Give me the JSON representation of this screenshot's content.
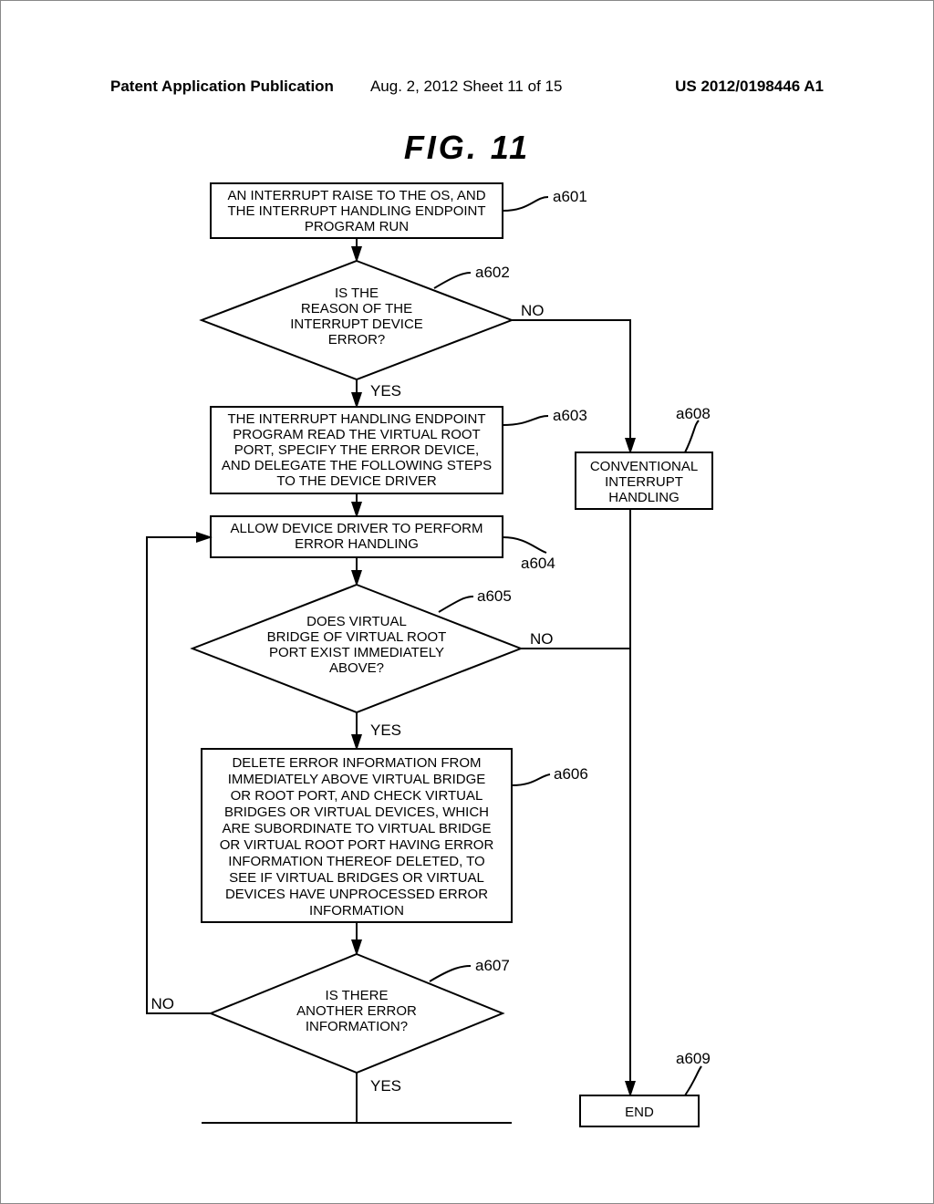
{
  "header": {
    "left": "Patent Application Publication",
    "center": "Aug. 2, 2012  Sheet 11 of 15",
    "right": "US 2012/0198446 A1"
  },
  "figure_title": "FIG.  11",
  "nodes": {
    "a601": {
      "lines": [
        "AN INTERRUPT RAISE TO THE OS, AND",
        "THE INTERRUPT HANDLING ENDPOINT",
        "PROGRAM RUN"
      ],
      "label": "a601"
    },
    "a602": {
      "lines": [
        "IS THE",
        "REASON OF THE",
        "INTERRUPT DEVICE",
        "ERROR?"
      ],
      "label": "a602",
      "yes": "YES",
      "no": "NO"
    },
    "a603": {
      "lines": [
        "THE INTERRUPT HANDLING ENDPOINT",
        "PROGRAM READ THE VIRTUAL ROOT",
        "PORT, SPECIFY THE ERROR DEVICE,",
        "AND DELEGATE THE FOLLOWING STEPS",
        "TO THE DEVICE DRIVER"
      ],
      "label": "a603"
    },
    "a604": {
      "lines": [
        "ALLOW DEVICE DRIVER TO PERFORM",
        "ERROR HANDLING"
      ],
      "label": "a604"
    },
    "a605": {
      "lines": [
        "DOES VIRTUAL",
        "BRIDGE OF VIRTUAL ROOT",
        "PORT EXIST IMMEDIATELY",
        "ABOVE?"
      ],
      "label": "a605",
      "yes": "YES",
      "no": "NO"
    },
    "a606": {
      "lines": [
        "DELETE ERROR INFORMATION FROM",
        "IMMEDIATELY ABOVE VIRTUAL BRIDGE",
        "OR ROOT PORT, AND CHECK VIRTUAL",
        "BRIDGES OR VIRTUAL DEVICES, WHICH",
        "ARE SUBORDINATE TO VIRTUAL BRIDGE",
        "OR VIRTUAL ROOT PORT HAVING ERROR",
        "INFORMATION THEREOF DELETED, TO",
        "SEE IF VIRTUAL BRIDGES OR VIRTUAL",
        "DEVICES HAVE UNPROCESSED ERROR",
        "INFORMATION"
      ],
      "label": "a606"
    },
    "a607": {
      "lines": [
        "IS THERE",
        "ANOTHER ERROR",
        "INFORMATION?"
      ],
      "label": "a607",
      "yes": "YES",
      "no": "NO"
    },
    "a608": {
      "lines": [
        "CONVENTIONAL",
        "INTERRUPT",
        "HANDLING"
      ],
      "label": "a608"
    },
    "a609": {
      "lines": [
        "END"
      ],
      "label": "a609"
    }
  },
  "chart_data": {
    "type": "flowchart",
    "title": "FIG. 11",
    "nodes": [
      {
        "id": "a601",
        "shape": "process",
        "text": "AN INTERRUPT RAISE TO THE OS, AND THE INTERRUPT HANDLING ENDPOINT PROGRAM RUN"
      },
      {
        "id": "a602",
        "shape": "decision",
        "text": "IS THE REASON OF THE INTERRUPT DEVICE ERROR?"
      },
      {
        "id": "a603",
        "shape": "process",
        "text": "THE INTERRUPT HANDLING ENDPOINT PROGRAM READ THE VIRTUAL ROOT PORT, SPECIFY THE ERROR DEVICE, AND DELEGATE THE FOLLOWING STEPS TO THE DEVICE DRIVER"
      },
      {
        "id": "a604",
        "shape": "process",
        "text": "ALLOW DEVICE DRIVER TO PERFORM ERROR HANDLING"
      },
      {
        "id": "a605",
        "shape": "decision",
        "text": "DOES VIRTUAL BRIDGE OF VIRTUAL ROOT PORT EXIST IMMEDIATELY ABOVE?"
      },
      {
        "id": "a606",
        "shape": "process",
        "text": "DELETE ERROR INFORMATION FROM IMMEDIATELY ABOVE VIRTUAL BRIDGE OR ROOT PORT, AND CHECK VIRTUAL BRIDGES OR VIRTUAL DEVICES, WHICH ARE SUBORDINATE TO VIRTUAL BRIDGE OR VIRTUAL ROOT PORT HAVING ERROR INFORMATION THEREOF DELETED, TO SEE IF VIRTUAL BRIDGES OR VIRTUAL DEVICES HAVE UNPROCESSED ERROR INFORMATION"
      },
      {
        "id": "a607",
        "shape": "decision",
        "text": "IS THERE ANOTHER ERROR INFORMATION?"
      },
      {
        "id": "a608",
        "shape": "process",
        "text": "CONVENTIONAL INTERRUPT HANDLING"
      },
      {
        "id": "a609",
        "shape": "terminator",
        "text": "END"
      }
    ],
    "edges": [
      {
        "from": "a601",
        "to": "a602"
      },
      {
        "from": "a602",
        "to": "a603",
        "label": "YES"
      },
      {
        "from": "a602",
        "to": "a608",
        "label": "NO"
      },
      {
        "from": "a603",
        "to": "a604"
      },
      {
        "from": "a604",
        "to": "a605"
      },
      {
        "from": "a605",
        "to": "a606",
        "label": "YES"
      },
      {
        "from": "a605",
        "to": "a608",
        "label": "NO",
        "note": "joins a602-NO path"
      },
      {
        "from": "a606",
        "to": "a607"
      },
      {
        "from": "a607",
        "to": "a604",
        "label": "NO",
        "note": "loop back"
      },
      {
        "from": "a607",
        "to": "a609",
        "label": "YES",
        "note": "through open connector"
      },
      {
        "from": "a608",
        "to": "a609"
      }
    ]
  }
}
